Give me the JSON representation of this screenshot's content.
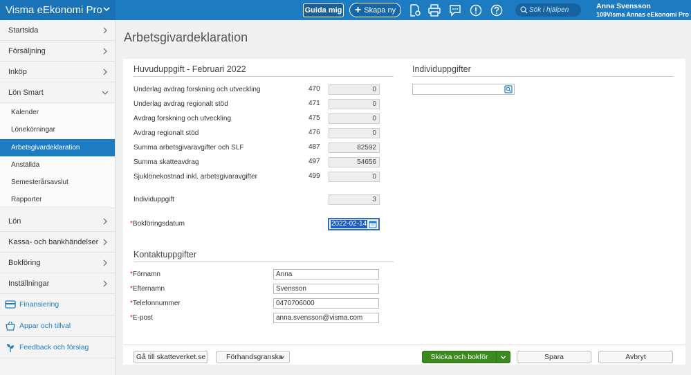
{
  "topbar": {
    "app_title": "Visma eEkonomi Pro",
    "guide_button": "Guida mig",
    "create_button": "Skapa ny",
    "search_placeholder": "Sök i hjälpen",
    "user_name": "Anna Svensson",
    "company": "109Visma Annas eEkonomi Pro",
    "icons": [
      "document-settings-icon",
      "print-icon",
      "chat-icon",
      "alert-icon",
      "help-icon"
    ]
  },
  "sidebar": {
    "items": [
      {
        "label": "Startsida"
      },
      {
        "label": "Försäljning"
      },
      {
        "label": "Inköp"
      },
      {
        "label": "Lön Smart"
      },
      {
        "label": "Lön"
      },
      {
        "label": "Kassa- och bankhändelser"
      },
      {
        "label": "Bokföring"
      },
      {
        "label": "Inställningar"
      }
    ],
    "subitems": [
      {
        "label": "Kalender"
      },
      {
        "label": "Lönekörningar"
      },
      {
        "label": "Arbetsgivardeklaration"
      },
      {
        "label": "Anställda"
      },
      {
        "label": "Semesterårsavslut"
      },
      {
        "label": "Rapporter"
      }
    ],
    "extras": [
      {
        "label": "Finansiering"
      },
      {
        "label": "Appar och tillval"
      },
      {
        "label": "Feedback och förslag"
      }
    ]
  },
  "page": {
    "title": "Arbetsgivardeklaration",
    "main_section_title": "Huvuduppgift - Februari 2022",
    "individual_section_title": "Individuppgifter",
    "rows": [
      {
        "label": "Underlag avdrag forskning och utveckling",
        "code": "470",
        "value": "0"
      },
      {
        "label": "Underlag avdrag regionalt stöd",
        "code": "471",
        "value": "0"
      },
      {
        "label": "Avdrag forskning och utveckling",
        "code": "475",
        "value": "0"
      },
      {
        "label": "Avdrag regionalt stöd",
        "code": "476",
        "value": "0"
      },
      {
        "label": "Summa arbetsgivaravgifter och SLF",
        "code": "487",
        "value": "82592"
      },
      {
        "label": "Summa skatteavdrag",
        "code": "497",
        "value": "54656"
      },
      {
        "label": "Sjuklönekostnad inkl. arbetsgivaravgifter",
        "code": "499",
        "value": "0"
      }
    ],
    "individ_label": "Individuppgift",
    "individ_value": "3",
    "booking_date_label": "Bokföringsdatum",
    "booking_date_value": "2022-02-14",
    "required_mark": "*",
    "contact_title": "Kontaktuppgifter",
    "contact": [
      {
        "label": "Förnamn",
        "value": "Anna"
      },
      {
        "label": "Efternamn",
        "value": "Svensson"
      },
      {
        "label": "Telefonnummer",
        "value": "0470706000"
      },
      {
        "label": "E-post",
        "value": "anna.svensson@visma.com"
      }
    ]
  },
  "footer": {
    "skatteverket_button": "Gå till skatteverket.se",
    "preview_button": "Förhandsgranska",
    "send_button": "Skicka och bokför",
    "save_button": "Spara",
    "cancel_button": "Avbryt"
  },
  "colors": {
    "brand_blue": "#1d7bc2",
    "active_nav": "#1d7bc2",
    "send_green": "#3a8a1e",
    "required": "#c62828"
  }
}
